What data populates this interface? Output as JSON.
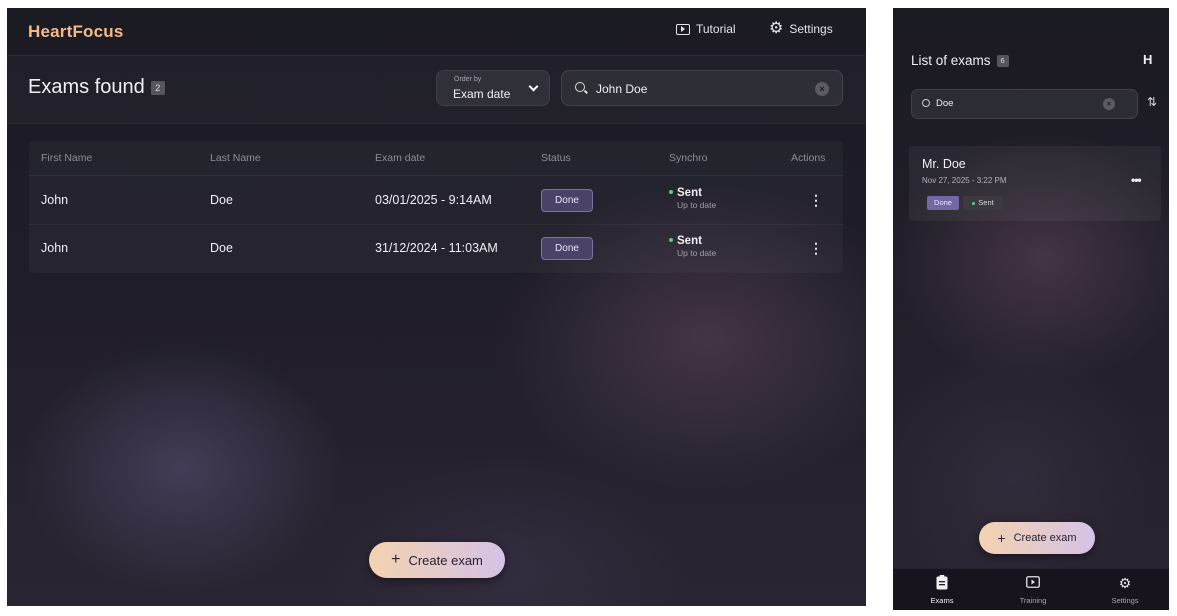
{
  "desktop": {
    "brand": "HeartFocus",
    "topbar": {
      "tutorial": "Tutorial",
      "settings": "Settings"
    },
    "header": {
      "title": "Exams found",
      "count": "2",
      "order_by_label": "Order by",
      "order_by_value": "Exam date",
      "search_value": "John Doe"
    },
    "table": {
      "columns": [
        "First Name",
        "Last Name",
        "Exam date",
        "Status",
        "Synchro",
        "Actions"
      ],
      "rows": [
        {
          "first": "John",
          "last": "Doe",
          "date": "03/01/2025 - 9:14AM",
          "status": "Done",
          "synchro": "Sent",
          "synchro_sub": "Up to date",
          "action": "⋮"
        },
        {
          "first": "John",
          "last": "Doe",
          "date": "31/12/2024 - 11:03AM",
          "status": "Done",
          "synchro": "Sent",
          "synchro_sub": "Up to date",
          "action": "⋮"
        }
      ]
    },
    "create_label": "Create exam",
    "plus": "+"
  },
  "mobile": {
    "title": "List of exams",
    "count": "6",
    "logo": "H",
    "search_value": "Doe",
    "sort_icon": "⇅",
    "card": {
      "name": "Mr. Doe",
      "date": "Nov 27, 2025 - 3:22 PM",
      "status": "Done",
      "synchro": "Sent",
      "menu": "•••"
    },
    "create_label": "Create exam",
    "plus": "+",
    "nav": [
      {
        "label": "Exams",
        "icon": "clipboard-icon",
        "active": true
      },
      {
        "label": "Training",
        "icon": "play-icon",
        "active": false
      },
      {
        "label": "Settings",
        "icon": "gear-icon",
        "active": false
      }
    ]
  },
  "colors": {
    "brand": "#f2b98a",
    "badge": "#4b4268",
    "sent_dot": "#4cd67c",
    "create_gradient_start": "#f4d2b0",
    "create_gradient_end": "#d5c2e6"
  }
}
